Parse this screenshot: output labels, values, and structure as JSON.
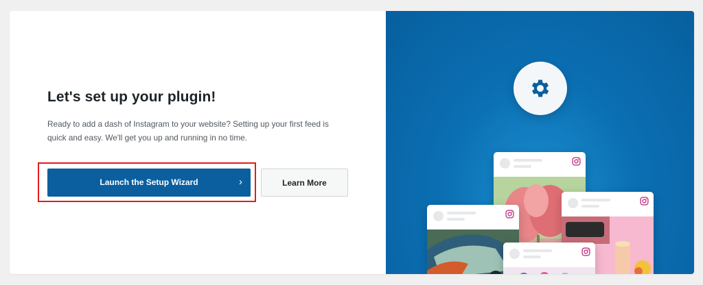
{
  "setup": {
    "title": "Let's set up your plugin!",
    "description": "Ready to add a dash of Instagram to your website? Setting up your first feed is quick and easy. We'll get you up and running in no time.",
    "primary_button": "Launch the Setup Wizard",
    "primary_chevron": "›",
    "secondary_button": "Learn More"
  },
  "colors": {
    "primary": "#0b5f9f",
    "highlight": "#e01b1b",
    "panel_bg": "#0b6fb3",
    "instagram": "#c13584"
  },
  "icons": [
    "gear-icon",
    "chevron-right-icon",
    "instagram-icon"
  ]
}
